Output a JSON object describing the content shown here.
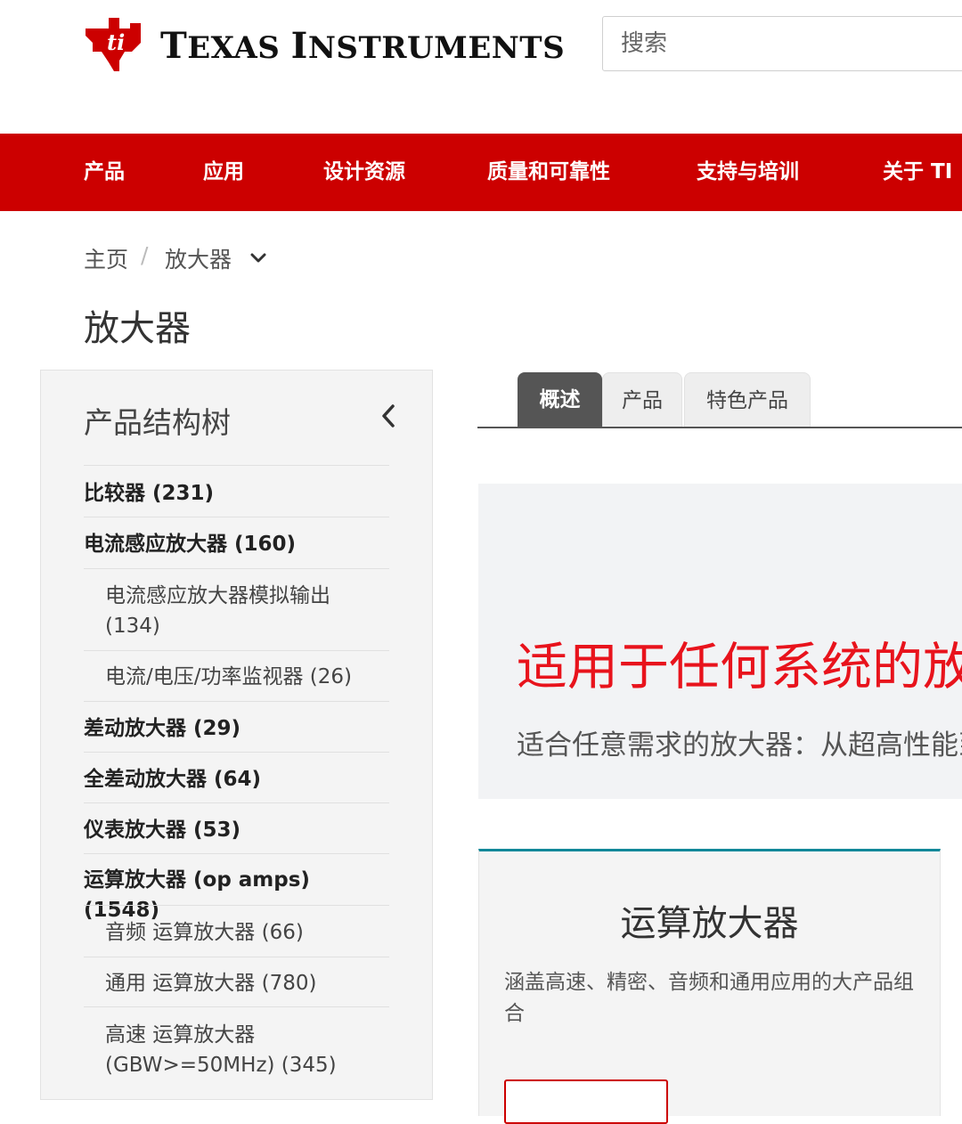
{
  "header": {
    "brand_first": "T",
    "brand_rest_1": "EXAS ",
    "brand_second": "I",
    "brand_rest_2": "NSTRUMENTS",
    "search_placeholder": "搜索",
    "logo_icon": "ti-logo-icon",
    "brand_color": "#cc0000"
  },
  "nav": {
    "items": [
      {
        "label": "产品"
      },
      {
        "label": "应用"
      },
      {
        "label": "设计资源"
      },
      {
        "label": "质量和可靠性"
      },
      {
        "label": "支持与培训"
      },
      {
        "label": "关于 TI"
      }
    ]
  },
  "breadcrumb": {
    "home": "主页",
    "separator": "/",
    "current": "放大器",
    "dropdown_icon": "chevron-down-icon"
  },
  "page": {
    "title": "放大器"
  },
  "sidebar": {
    "title": "产品结构树",
    "collapse_icon": "chevron-left-icon",
    "items": [
      {
        "label": "比较器 (231)",
        "level": 1
      },
      {
        "label": "电流感应放大器 (160)",
        "level": 1
      },
      {
        "label": "电流感应放大器模拟输出 (134)",
        "level": 2
      },
      {
        "label": "电流/电压/功率监视器 (26)",
        "level": 2
      },
      {
        "label": "差动放大器 (29)",
        "level": 1
      },
      {
        "label": "全差动放大器 (64)",
        "level": 1
      },
      {
        "label": "仪表放大器 (53)",
        "level": 1
      },
      {
        "label": "运算放大器 (op amps) (1548)",
        "level": 1
      },
      {
        "label": "音频 运算放大器 (66)",
        "level": 2
      },
      {
        "label": "通用 运算放大器 (780)",
        "level": 2
      },
      {
        "label": "高速 运算放大器 (GBW>=50MHz) (345)",
        "level": 2
      }
    ]
  },
  "tabs": [
    {
      "label": "概述",
      "active": true
    },
    {
      "label": "产品",
      "active": false
    },
    {
      "label": "特色产品",
      "active": false
    }
  ],
  "hero": {
    "title": "适用于任何系统的放大器",
    "subtitle": "适合任意需求的放大器：从超高性能到低成本",
    "background": "#f2f3f5",
    "title_color": "#e8131c"
  },
  "card": {
    "title": "运算放大器",
    "description": "涵盖高速、精密、音频和通用应用的大产品组合",
    "accent": "#118899"
  }
}
